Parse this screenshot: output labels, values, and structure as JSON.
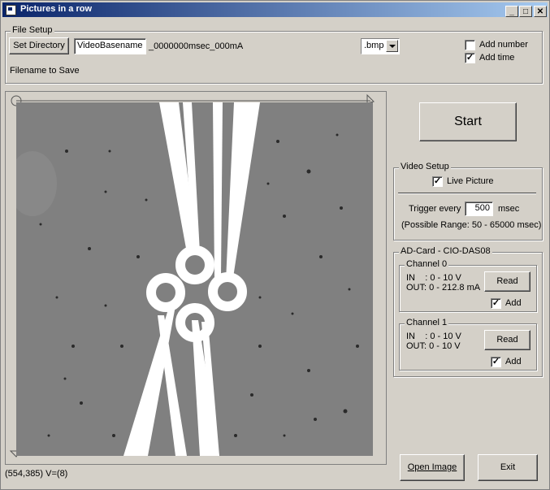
{
  "window": {
    "title": "Pictures in a row",
    "minimize": "_",
    "maximize": "□",
    "close": "✕"
  },
  "file_setup": {
    "label": "File Setup",
    "set_directory": "Set Directory",
    "basename": "VideoBasename",
    "suffix": "_0000000msec_000mA",
    "filetype": ".bmp",
    "add_number_label": "Add number",
    "add_number_checked": false,
    "add_time_label": "Add time",
    "add_time_checked": true,
    "filename_caption": "Filename to Save"
  },
  "start_button": "Start",
  "video_setup": {
    "label": "Video Setup",
    "live_picture_label": "Live Picture",
    "live_picture_checked": true,
    "trigger_label": "Trigger every",
    "trigger_value": "500",
    "trigger_unit": "msec",
    "range_text": "(Possible Range: 50 - 65000 msec)"
  },
  "ad_card": {
    "label": "AD-Card - CIO-DAS08",
    "channels": [
      {
        "label": "Channel 0",
        "in": "IN    : 0 - 10 V",
        "out": "OUT: 0 - 212.8 mA",
        "read": "Read",
        "add_label": "Add",
        "add_checked": true
      },
      {
        "label": "Channel 1",
        "in": "IN    : 0 - 10 V",
        "out": "OUT: 0 - 10 V",
        "read": "Read",
        "add_label": "Add",
        "add_checked": true
      }
    ]
  },
  "open_image": "Open Image",
  "exit": "Exit",
  "status": "(554,385)  V=(8)"
}
